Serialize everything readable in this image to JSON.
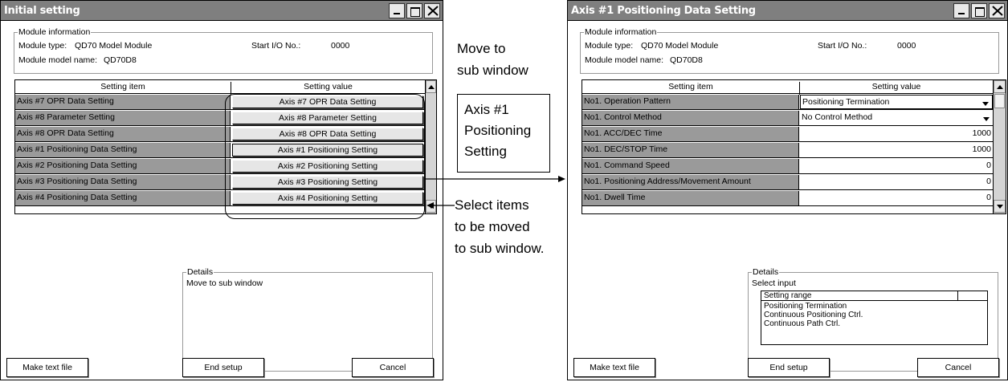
{
  "left_window": {
    "title": "Initial setting",
    "module_info": {
      "legend": "Module information",
      "type_label": "Module type:",
      "type_value": "QD70 Model Module",
      "start_io_label": "Start I/O No.:",
      "start_io_value": "0000",
      "model_label": "Module model name:",
      "model_value": "QD70D8"
    },
    "grid": {
      "col_item": "Setting item",
      "col_value": "Setting value",
      "rows": [
        {
          "item": "Axis #7 OPR Data Setting",
          "value": "Axis #7 OPR Data Setting"
        },
        {
          "item": "Axis #8 Parameter Setting",
          "value": "Axis #8 Parameter Setting"
        },
        {
          "item": "Axis #8 OPR Data Setting",
          "value": "Axis #8 OPR Data Setting"
        },
        {
          "item": "Axis #1 Positioning Data Setting",
          "value": "Axis #1 Positioning Setting"
        },
        {
          "item": "Axis #2 Positioning Data Setting",
          "value": "Axis #2 Positioning Setting"
        },
        {
          "item": "Axis #3 Positioning Data Setting",
          "value": "Axis #3 Positioning Setting"
        },
        {
          "item": "Axis #4 Positioning Data Setting",
          "value": "Axis #4 Positioning Setting"
        }
      ]
    },
    "details": {
      "legend": "Details",
      "text": "Move to sub window"
    },
    "buttons": {
      "make_text": "Make text file",
      "end_setup": "End setup",
      "cancel": "Cancel"
    }
  },
  "right_window": {
    "title": "Axis #1 Positioning Data Setting",
    "module_info": {
      "legend": "Module information",
      "type_label": "Module type:",
      "type_value": "QD70 Model Module",
      "start_io_label": "Start I/O No.:",
      "start_io_value": "0000",
      "model_label": "Module model name:",
      "model_value": "QD70D8"
    },
    "grid": {
      "col_item": "Setting item",
      "col_value": "Setting value",
      "rows": [
        {
          "item": "No1. Operation Pattern",
          "value": "Positioning Termination",
          "kind": "select"
        },
        {
          "item": "No1. Control Method",
          "value": "No Control Method",
          "kind": "select"
        },
        {
          "item": "No1. ACC/DEC Time",
          "value": "1000",
          "kind": "number"
        },
        {
          "item": "No1. DEC/STOP Time",
          "value": "1000",
          "kind": "number"
        },
        {
          "item": "No1. Command Speed",
          "value": "0",
          "kind": "number"
        },
        {
          "item": "No1. Positioning Address/Movement Amount",
          "value": "0",
          "kind": "number"
        },
        {
          "item": "No1. Dwell Time",
          "value": "0",
          "kind": "number"
        }
      ]
    },
    "details": {
      "legend": "Details",
      "text": "Select input",
      "range_header": "Setting range",
      "range_options": [
        "Positioning Termination",
        "Continuous Positioning Ctrl.",
        "Continuous Path Ctrl."
      ]
    },
    "buttons": {
      "make_text": "Make text file",
      "end_setup": "End setup",
      "cancel": "Cancel"
    }
  },
  "annotations": {
    "move_to_line1": "Move to",
    "move_to_line2": "sub window",
    "box_line1": "Axis #1",
    "box_line2": "Positioning",
    "box_line3": "Setting",
    "select_line1": "Select items",
    "select_line2": "to be moved",
    "select_line3": "to sub window."
  }
}
